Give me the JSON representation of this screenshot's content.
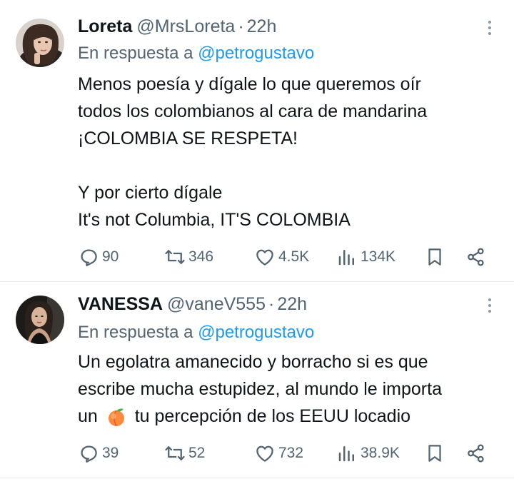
{
  "tweets": [
    {
      "name": "Loreta",
      "handle": "@MrsLoreta",
      "separator": "·",
      "time": "22h",
      "reply_prefix": "En respuesta a",
      "reply_mention": "@petrogustavo",
      "body_lines": [
        "Menos poesía y dígale lo que queremos oír",
        "todos los colombianos al cara de  mandarina",
        "¡COLOMBIA SE RESPETA!",
        "",
        "Y por cierto dígale",
        "It's not Columbia, IT'S COLOMBIA"
      ],
      "replies": "90",
      "retweets": "346",
      "likes": "4.5K",
      "views": "134K"
    },
    {
      "name": "VANESSA",
      "handle": "@vaneV555",
      "separator": "·",
      "time": "22h",
      "reply_prefix": "En respuesta a",
      "reply_mention": "@petrogustavo",
      "body_lines": [
        "Un egolatra amanecido y borracho si es que",
        "escribe mucha estupidez, al mundo le importa",
        "un",
        "tu percepción de los EEUU locadio"
      ],
      "replies": "39",
      "retweets": "52",
      "likes": "732",
      "views": "38.9K"
    }
  ],
  "icons": {
    "reply": "reply-icon",
    "retweet": "retweet-icon",
    "like": "heart-icon",
    "views": "views-icon",
    "bookmark": "bookmark-icon",
    "share": "share-icon",
    "more": "more-icon",
    "peach": "peach-emoji"
  },
  "colors": {
    "text": "#0f1419",
    "secondary": "#536471",
    "link": "#1d9bf0",
    "divider": "#e6e9ec"
  }
}
